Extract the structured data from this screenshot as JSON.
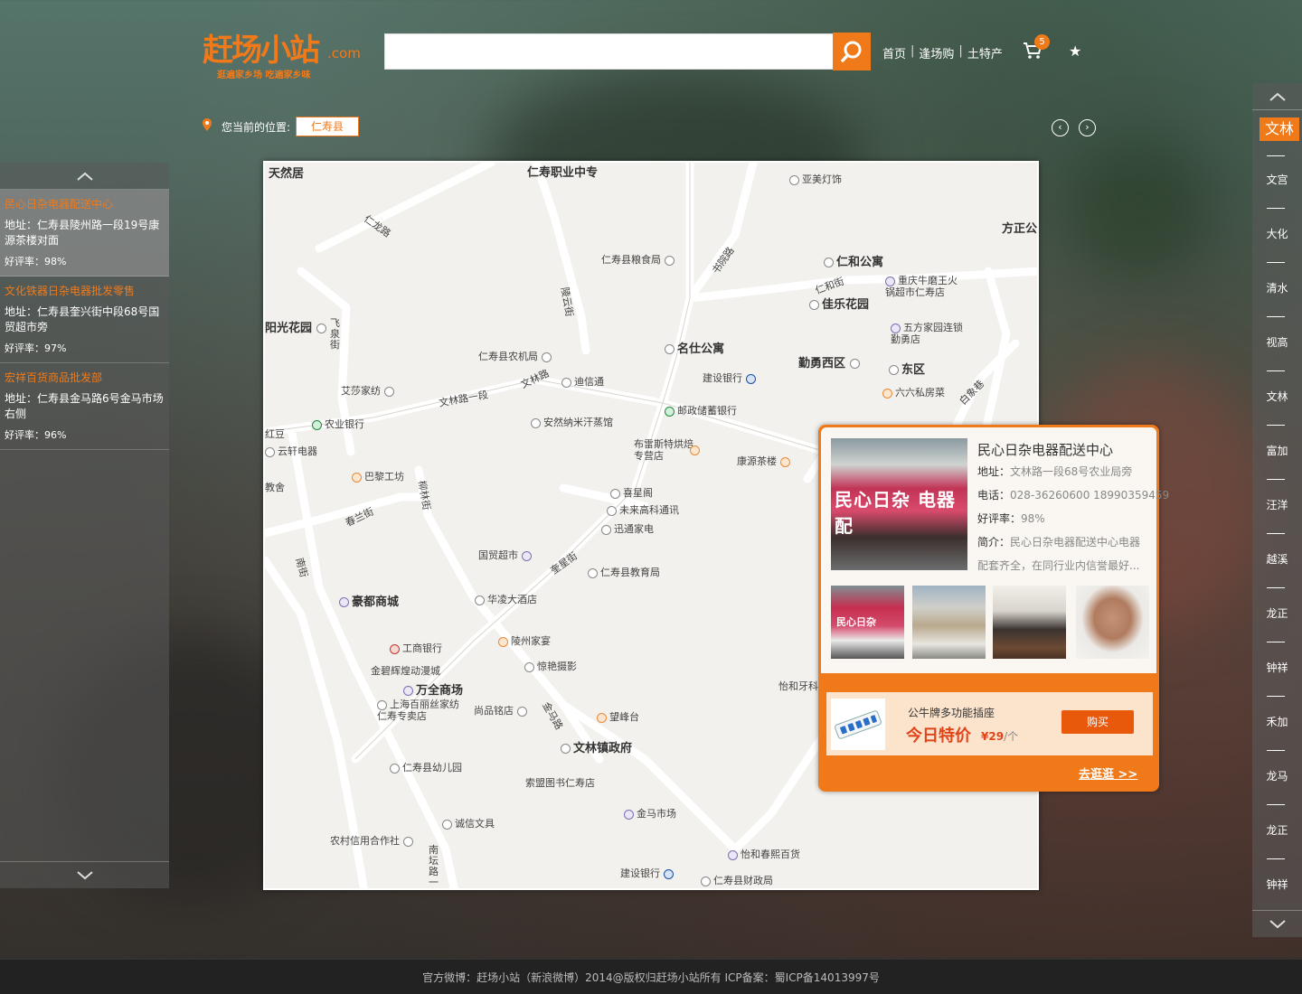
{
  "header": {
    "logo_text": "赶场小站",
    "logo_com": ".com",
    "logo_slogan": "逛遍家乡场  吃遍家乡味",
    "search_placeholder": "",
    "nav": [
      "首页",
      "逢场购",
      "土特产"
    ],
    "cart_count": "5"
  },
  "location": {
    "label": "您当前的位置:",
    "value": "仁寿县"
  },
  "left_list": [
    {
      "name": "民心日杂电器配送中心",
      "addr": "地址：仁寿县陵州路一段19号康源茶楼对面",
      "rate": "好评率：98%"
    },
    {
      "name": "文化铁器日杂电器批发零售",
      "addr": "地址：仁寿县奎兴街中段68号国贸超市旁",
      "rate": "好评率：97%"
    },
    {
      "name": "宏祥百货商品批发部",
      "addr": "地址：仁寿县金马路6号金马市场右侧",
      "rate": "好评率：96%"
    }
  ],
  "map_labels": {
    "tianranju": "天然居",
    "zhiye": "仁寿职业中专",
    "yamei": "亚美灯饰",
    "renlong": "仁龙路",
    "fangzheng": "方正公",
    "liangshi": "仁寿县粮食局",
    "shubang": "书院路",
    "renhe": "仁和公寓",
    "renhe_road": "仁和街",
    "chongqing": "重庆牛磨王火锅超市仁寿店",
    "jiale": "佳乐花园",
    "yangguang": "阳光花园",
    "feiquan": "飞泉街",
    "lingyunjie": "陵云街",
    "wufang": "五方家园连锁勤勇店",
    "nongji": "仁寿县农机局",
    "mingshi": "名仕公寓",
    "qinyong": "勤勇西区",
    "dongqu": "东区",
    "aisha": "艾莎家纺",
    "wenlin1": "文林路一段",
    "wenlin2": "文林路",
    "dixin": "迪信通",
    "jianshe1": "建设银行",
    "liuba": "六六私房菜",
    "baixiang": "白象巷",
    "youzheng": "邮政储蓄银行",
    "hongdou": "红豆",
    "nongye": "农业银行",
    "anran": "安然纳米汗蒸馆",
    "yunxuan": "云轩电器",
    "bulaisi": "布雷斯特烘焙专营店",
    "kangyuan": "康源茶楼",
    "bali": "巴黎工坊",
    "jiaoshe": "教舍",
    "chunlan": "春兰街",
    "xixing": "喜星阁",
    "weilai": "未来高科通讯",
    "xuntong": "迅通家电",
    "liulin": "柳林街",
    "nanjie": "南街",
    "guomao": "国贸超市",
    "kuixing": "奎星街",
    "jiaoyu": "仁寿县教育局",
    "haodu": "豪都商城",
    "hualing": "华凌大酒店",
    "gongshang": "工商银行",
    "lingzhou": "陵州家宴",
    "jinbi": "金碧辉煌动漫城",
    "jingyan": "惊艳摄影",
    "wanquan": "万全商场",
    "yihe": "怡和牙科",
    "shanghai": "上海百丽丝家纺仁寿专卖店",
    "shangpin": "尚品铭店",
    "jinma_road": "金马路",
    "wangfeng": "望峰台",
    "wenlinzhen": "文林镇政府",
    "youer": "仁寿县幼儿园",
    "suomeng": "索盟图书仁寿店",
    "jinma": "金马市场",
    "chengxin": "诚信文具",
    "nongcun": "农村信用合作社",
    "nantan": "南坛路一段",
    "yihechun": "怡和春熙百货",
    "jianshe2": "建设银行",
    "caizheng": "仁寿县财政局"
  },
  "popup": {
    "title": "民心日杂电器配送中心",
    "addr_label": "地址：",
    "addr": "文林路一段68号农业局旁",
    "tel_label": "电话：",
    "tel": "028-36260600   18990359459",
    "rate_label": "好评率：",
    "rate": "98%",
    "intro_label": "简介：",
    "intro1": "民心日杂电器配送中心电器",
    "intro2": "配套齐全，在同行业内信誉最好...",
    "shop_sign": "民心日杂 电器配",
    "thumb1_sign": "民心日杂",
    "deal_name": "公牛牌多功能插座",
    "deal_today": "今日特价",
    "deal_price": "¥29",
    "deal_unit": "/个",
    "deal_buy": "购买",
    "go_shop": "去逛逛 >>"
  },
  "right_nav": [
    "文林",
    "文宫",
    "大化",
    "清水",
    "视高",
    "文林",
    "富加",
    "汪洋",
    "越溪",
    "龙正",
    "钟祥",
    "禾加",
    "龙马",
    "龙正",
    "钟祥"
  ],
  "footer": "官方微博：赶场小站（新浪微博）2014@版权归赶场小站所有   ICP备案：蜀ICP备14013997号"
}
